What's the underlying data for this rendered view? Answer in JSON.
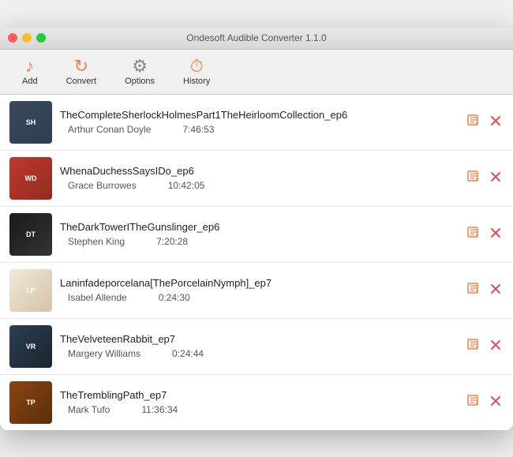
{
  "window": {
    "title": "Ondesoft Audible Converter 1.1.0"
  },
  "toolbar": {
    "add_label": "Add",
    "convert_label": "Convert",
    "options_label": "Options",
    "history_label": "History"
  },
  "books": [
    {
      "id": 1,
      "title": "TheCompleteSherlockHolmesPart1TheHeirloomCollection_ep6",
      "author": "Arthur Conan Doyle",
      "duration": "7:46:53",
      "cover_class": "cover-1",
      "cover_text": "SH"
    },
    {
      "id": 2,
      "title": "WhenaDuchessSaysIDo_ep6",
      "author": "Grace Burrowes",
      "duration": "10:42:05",
      "cover_class": "cover-2",
      "cover_text": "WD"
    },
    {
      "id": 3,
      "title": "TheDarkTowerITheGunslinger_ep6",
      "author": "Stephen King",
      "duration": "7:20:28",
      "cover_class": "cover-3",
      "cover_text": "DT"
    },
    {
      "id": 4,
      "title": "Laninfadeporcelana[ThePorcelainNymph]_ep7",
      "author": "Isabel Allende",
      "duration": "0:24:30",
      "cover_class": "cover-4",
      "cover_text": "LP"
    },
    {
      "id": 5,
      "title": "TheVelveteenRabbit_ep7",
      "author": "Margery Williams",
      "duration": "0:24:44",
      "cover_class": "cover-5",
      "cover_text": "VR"
    },
    {
      "id": 6,
      "title": "TheTremblingPath_ep7",
      "author": "Mark Tufo",
      "duration": "11:36:34",
      "cover_class": "cover-6",
      "cover_text": "TP"
    }
  ],
  "actions": {
    "edit_icon": "✎",
    "delete_icon": "✕"
  }
}
